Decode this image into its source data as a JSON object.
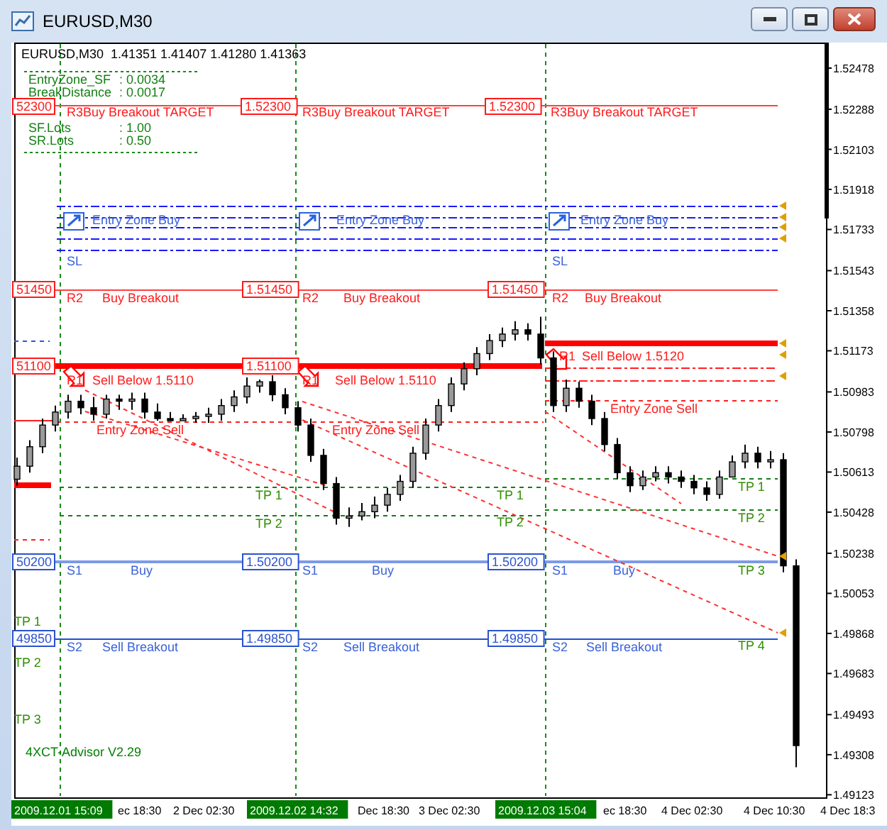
{
  "window": {
    "title": "EURUSD,M30"
  },
  "chart": {
    "header": "EURUSD,M30  1.41351 1.41407 1.41280 1.41363",
    "info": [
      {
        "label": "EntryZone_SF",
        "value": ": 0.0034"
      },
      {
        "label": "BreakDistance",
        "value": ": 0.0017"
      },
      {
        "label": "SF.Lots",
        "value": ": 1.00"
      },
      {
        "label": "SR.Lots",
        "value": ": 0.50"
      }
    ],
    "labels": [
      {
        "kind": "red_box",
        "text": "52300"
      },
      {
        "kind": "red",
        "text": "R3Buy Breakout TARGET"
      },
      {
        "kind": "red_box",
        "text": "1.52300"
      },
      {
        "kind": "red",
        "text": "R3Buy Breakout TARGET"
      },
      {
        "kind": "red_box",
        "text": "1.52300"
      },
      {
        "kind": "red",
        "text": "R3Buy Breakout TARGET"
      },
      {
        "kind": "blue",
        "text": "Entry Zone Buy"
      },
      {
        "kind": "blue",
        "text": "Entry Zone Buy"
      },
      {
        "kind": "blue",
        "text": "Entry Zone Buy"
      },
      {
        "kind": "blue",
        "text": "SL"
      },
      {
        "kind": "blue",
        "text": "SL"
      },
      {
        "kind": "red_box",
        "text": "51450"
      },
      {
        "kind": "red",
        "text": "R2"
      },
      {
        "kind": "red",
        "text": "Buy Breakout"
      },
      {
        "kind": "red_box",
        "text": "1.51450"
      },
      {
        "kind": "red",
        "text": "R2"
      },
      {
        "kind": "red",
        "text": "Buy Breakout"
      },
      {
        "kind": "red_box",
        "text": "1.51450"
      },
      {
        "kind": "red",
        "text": "R2"
      },
      {
        "kind": "red",
        "text": "Buy Breakout"
      },
      {
        "kind": "red_box",
        "text": "51100"
      },
      {
        "kind": "red",
        "text": "R1"
      },
      {
        "kind": "red",
        "text": "Sell Below 1.5110"
      },
      {
        "kind": "red_box",
        "text": "1.51100"
      },
      {
        "kind": "red",
        "text": "R1"
      },
      {
        "kind": "red",
        "text": "Sell Below 1.5110"
      },
      {
        "kind": "red",
        "text": "R1"
      },
      {
        "kind": "red",
        "text": "Sell Below 1.5120"
      },
      {
        "kind": "red",
        "text": "Entry Zone Sell"
      },
      {
        "kind": "red",
        "text": "Entry Zone Sell"
      },
      {
        "kind": "red",
        "text": "Entry Zone Sell"
      },
      {
        "kind": "tp",
        "text": "TP 1"
      },
      {
        "kind": "tp",
        "text": "TP 2"
      },
      {
        "kind": "tp",
        "text": "TP 1"
      },
      {
        "kind": "tp",
        "text": "TP 2"
      },
      {
        "kind": "tp",
        "text": "TP 1"
      },
      {
        "kind": "tp",
        "text": "TP 2"
      },
      {
        "kind": "tp",
        "text": "TP 3"
      },
      {
        "kind": "tp",
        "text": "TP 4"
      },
      {
        "kind": "blue_box",
        "text": "50200"
      },
      {
        "kind": "blue",
        "text": "S1"
      },
      {
        "kind": "blue",
        "text": "Buy"
      },
      {
        "kind": "blue_box",
        "text": "1.50200"
      },
      {
        "kind": "blue",
        "text": "S1"
      },
      {
        "kind": "blue",
        "text": "Buy"
      },
      {
        "kind": "blue_box",
        "text": "1.50200"
      },
      {
        "kind": "blue",
        "text": "S1"
      },
      {
        "kind": "blue",
        "text": "Buy"
      },
      {
        "kind": "blue_box",
        "text": "49850"
      },
      {
        "kind": "blue",
        "text": "S2"
      },
      {
        "kind": "blue",
        "text": "Sell Breakout"
      },
      {
        "kind": "blue_box",
        "text": "1.49850"
      },
      {
        "kind": "blue",
        "text": "S2"
      },
      {
        "kind": "blue",
        "text": "Sell Breakout"
      },
      {
        "kind": "blue_box",
        "text": "1.49850"
      },
      {
        "kind": "blue",
        "text": "S2"
      },
      {
        "kind": "blue",
        "text": "Sell Breakout"
      },
      {
        "kind": "tp",
        "text": "TP 1"
      },
      {
        "kind": "tp",
        "text": "TP 2"
      },
      {
        "kind": "tp",
        "text": "TP 3"
      },
      {
        "kind": "green",
        "text": "4XCT-Advisor V2.29"
      }
    ],
    "chart_data": {
      "type": "candlestick",
      "ylim": [
        1.49111,
        1.52596
      ],
      "yticks": [
        1.52478,
        1.52288,
        1.52103,
        1.51918,
        1.51733,
        1.51543,
        1.51358,
        1.51173,
        1.50983,
        1.50798,
        1.50613,
        1.50428,
        1.50238,
        1.50053,
        1.49868,
        1.49683,
        1.49493,
        1.49308,
        1.49123
      ],
      "categories": [
        null,
        null,
        null,
        null,
        null,
        null,
        null,
        null,
        null,
        null,
        null,
        null,
        null,
        null,
        null,
        null,
        null,
        null,
        null,
        null,
        null,
        null,
        null,
        null,
        null,
        null,
        null,
        null,
        null,
        null,
        null,
        null,
        null,
        null,
        null,
        null,
        null,
        null,
        null,
        null,
        null,
        null,
        null,
        null,
        null,
        null,
        null,
        null,
        null,
        null,
        null,
        null,
        null,
        null,
        null,
        null,
        null,
        null,
        null,
        null,
        null,
        null
      ],
      "ohlc": [
        [
          1.5058,
          1.5068,
          1.5055,
          1.5064
        ],
        [
          1.5064,
          1.5076,
          1.5061,
          1.5073
        ],
        [
          1.5073,
          1.5086,
          1.507,
          1.5083
        ],
        [
          1.5083,
          1.5092,
          1.508,
          1.5089
        ],
        [
          1.5089,
          1.5097,
          1.5086,
          1.5094
        ],
        [
          1.5094,
          1.5097,
          1.5088,
          1.5091
        ],
        [
          1.5091,
          1.5096,
          1.5085,
          1.5088
        ],
        [
          1.5088,
          1.5097,
          1.5086,
          1.5095
        ],
        [
          1.5095,
          1.5097,
          1.509,
          1.5094
        ],
        [
          1.5094,
          1.5098,
          1.509,
          1.5095
        ],
        [
          1.5095,
          1.5098,
          1.5086,
          1.5089
        ],
        [
          1.5089,
          1.5093,
          1.5085,
          1.5086
        ],
        [
          1.5086,
          1.5089,
          1.5085,
          1.5085
        ],
        [
          1.5085,
          1.5088,
          1.5085,
          1.5086
        ],
        [
          1.5086,
          1.5089,
          1.5084,
          1.5087
        ],
        [
          1.5087,
          1.5091,
          1.5084,
          1.5088
        ],
        [
          1.5088,
          1.5095,
          1.5085,
          1.5092
        ],
        [
          1.5092,
          1.5099,
          1.5089,
          1.5096
        ],
        [
          1.5096,
          1.5105,
          1.5093,
          1.5101
        ],
        [
          1.5101,
          1.5104,
          1.5098,
          1.5103
        ],
        [
          1.5103,
          1.5106,
          1.5094,
          1.5097
        ],
        [
          1.5097,
          1.51,
          1.5088,
          1.5091
        ],
        [
          1.5091,
          1.5094,
          1.508,
          1.5083
        ],
        [
          1.5083,
          1.5086,
          1.5066,
          1.5069
        ],
        [
          1.5069,
          1.5072,
          1.5053,
          1.5056
        ],
        [
          1.5056,
          1.5059,
          1.5037,
          1.504
        ],
        [
          1.504,
          1.5045,
          1.5036,
          1.5041
        ],
        [
          1.5041,
          1.5047,
          1.5039,
          1.5043
        ],
        [
          1.5043,
          1.505,
          1.504,
          1.5046
        ],
        [
          1.5046,
          1.5054,
          1.5043,
          1.5051
        ],
        [
          1.5051,
          1.506,
          1.5048,
          1.5057
        ],
        [
          1.5057,
          1.5073,
          1.5054,
          1.507
        ],
        [
          1.507,
          1.5086,
          1.5067,
          1.5083
        ],
        [
          1.5083,
          1.5095,
          1.508,
          1.5092
        ],
        [
          1.5092,
          1.5105,
          1.5089,
          1.5102
        ],
        [
          1.5102,
          1.5112,
          1.5099,
          1.5109
        ],
        [
          1.5109,
          1.5119,
          1.5106,
          1.5116
        ],
        [
          1.5116,
          1.5125,
          1.5113,
          1.5122
        ],
        [
          1.5122,
          1.5128,
          1.5119,
          1.5125
        ],
        [
          1.5125,
          1.5131,
          1.5122,
          1.5127
        ],
        [
          1.5127,
          1.513,
          1.5122,
          1.5125
        ],
        [
          1.5125,
          1.5133,
          1.5111,
          1.5114
        ],
        [
          1.5114,
          1.5117,
          1.5089,
          1.5092
        ],
        [
          1.5092,
          1.5104,
          1.5089,
          1.51
        ],
        [
          1.51,
          1.5103,
          1.5091,
          1.5094
        ],
        [
          1.5094,
          1.5097,
          1.5083,
          1.5086
        ],
        [
          1.5086,
          1.5089,
          1.5071,
          1.5074
        ],
        [
          1.5074,
          1.5077,
          1.5058,
          1.5061
        ],
        [
          1.5061,
          1.5064,
          1.5052,
          1.5055
        ],
        [
          1.5055,
          1.5062,
          1.5053,
          1.5059
        ],
        [
          1.5059,
          1.5064,
          1.5057,
          1.5061
        ],
        [
          1.5061,
          1.5064,
          1.5056,
          1.5059
        ],
        [
          1.5059,
          1.5062,
          1.5054,
          1.5057
        ],
        [
          1.5057,
          1.506,
          1.5051,
          1.5054
        ],
        [
          1.5054,
          1.5057,
          1.5048,
          1.5051
        ],
        [
          1.5051,
          1.5062,
          1.5049,
          1.5059
        ],
        [
          1.5059,
          1.5069,
          1.5059,
          1.5066
        ],
        [
          1.5066,
          1.5074,
          1.5063,
          1.507
        ],
        [
          1.507,
          1.5073,
          1.5063,
          1.5066
        ],
        [
          1.5066,
          1.5071,
          1.5063,
          1.5067
        ],
        [
          1.5067,
          1.507,
          1.5015,
          1.5018
        ],
        [
          1.5018,
          1.5021,
          1.4925,
          1.4935
        ]
      ]
    },
    "time_axis": [
      {
        "kind": "marker",
        "text": "2009.12.01 15:09"
      },
      {
        "kind": "tick",
        "text": "ec 18:30"
      },
      {
        "kind": "tick",
        "text": "2 Dec 02:30"
      },
      {
        "kind": "marker",
        "text": "2009.12.02 14:32"
      },
      {
        "kind": "tick",
        "text": "Dec 18:30"
      },
      {
        "kind": "tick",
        "text": "3 Dec 02:30"
      },
      {
        "kind": "marker",
        "text": "2009.12.03 15:04"
      },
      {
        "kind": "tick",
        "text": "ec 18:30"
      },
      {
        "kind": "tick",
        "text": "4 Dec 02:30"
      },
      {
        "kind": "tick",
        "text": "4 Dec 10:30"
      },
      {
        "kind": "tick",
        "text": "4 Dec 18:3"
      }
    ]
  }
}
